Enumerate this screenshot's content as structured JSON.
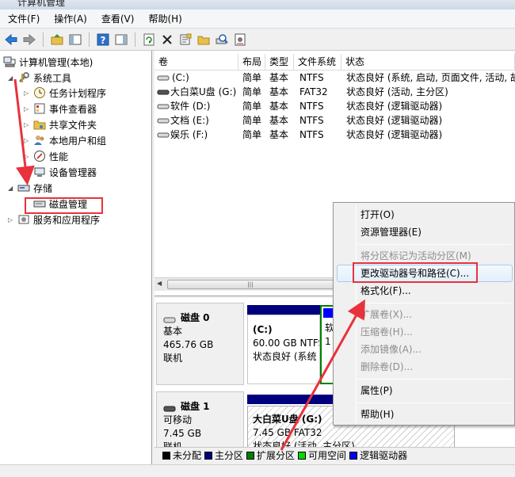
{
  "window": {
    "title": "计算机管理"
  },
  "menu": [
    "文件(F)",
    "操作(A)",
    "查看(V)",
    "帮助(H)"
  ],
  "toolbar_icons": [
    "back-icon",
    "forward-icon",
    "up-folder-icon",
    "console-tree-icon",
    "help-icon",
    "action-pane-icon",
    "refresh-icon",
    "delete-icon",
    "properties-icon",
    "open-folder-icon",
    "search-disk-icon",
    "settings-icon"
  ],
  "tree": {
    "root": "计算机管理(本地)",
    "system_tools": "系统工具",
    "task_scheduler": "任务计划程序",
    "event_viewer": "事件查看器",
    "shared_folders": "共享文件夹",
    "local_users": "本地用户和组",
    "performance": "性能",
    "device_manager": "设备管理器",
    "storage": "存储",
    "disk_management": "磁盘管理",
    "services": "服务和应用程序"
  },
  "volumes": {
    "headers": [
      "卷",
      "布局",
      "类型",
      "文件系统",
      "状态"
    ],
    "rows": [
      [
        "(C:)",
        "简单",
        "基本",
        "NTFS",
        "状态良好 (系统, 启动, 页面文件, 活动, 故"
      ],
      [
        "大白菜U盘 (G:)",
        "简单",
        "基本",
        "FAT32",
        "状态良好 (活动, 主分区)"
      ],
      [
        "软件 (D:)",
        "简单",
        "基本",
        "NTFS",
        "状态良好 (逻辑驱动器)"
      ],
      [
        "文档 (E:)",
        "简单",
        "基本",
        "NTFS",
        "状态良好 (逻辑驱动器)"
      ],
      [
        "娱乐 (F:)",
        "简单",
        "基本",
        "NTFS",
        "状态良好 (逻辑驱动器)"
      ]
    ]
  },
  "disks": {
    "disk0": {
      "name": "磁盘 0",
      "type": "基本",
      "size": "465.76 GB",
      "status": "联机",
      "c_name": "(C:)",
      "c_size": "60.00 GB NTFS",
      "c_status": "状态良好 (系统",
      "ext_frag1": "软",
      "ext_frag2": "1"
    },
    "disk1": {
      "name": "磁盘 1",
      "type": "可移动",
      "size": "7.45 GB",
      "status": "联机",
      "g_name": "大白菜U盘 (G:)",
      "g_size": "7.45 GB FAT32",
      "g_status": "状态良好 (活动, 主分区)"
    }
  },
  "legend": [
    "未分配",
    "主分区",
    "扩展分区",
    "可用空间",
    "逻辑驱动器"
  ],
  "legend_colors": [
    "#000000",
    "#00007f",
    "#008000",
    "#00d800",
    "#0000ff"
  ],
  "context_menu": {
    "open": "打开(O)",
    "explorer": "资源管理器(E)",
    "mark_active": "将分区标记为活动分区(M)",
    "change_letter": "更改驱动器号和路径(C)...",
    "format": "格式化(F)...",
    "extend": "扩展卷(X)...",
    "shrink": "压缩卷(H)...",
    "mirror": "添加镜像(A)...",
    "delete": "删除卷(D)...",
    "properties": "属性(P)",
    "help": "帮助(H)"
  }
}
